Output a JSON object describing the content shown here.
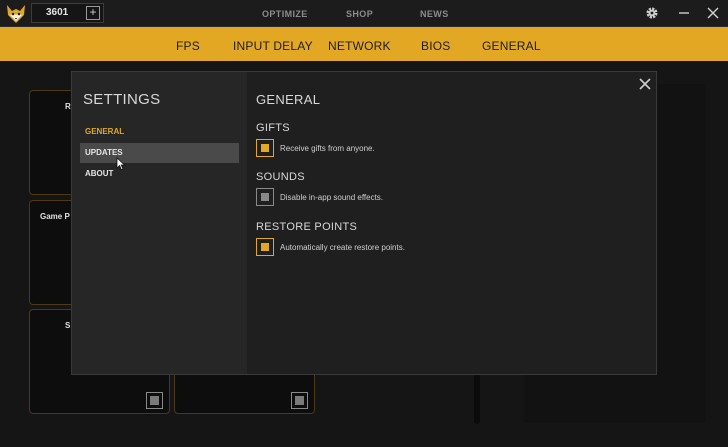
{
  "topbar": {
    "counter_value": "3601",
    "nav": [
      "OPTIMIZE",
      "SHOP",
      "NEWS"
    ]
  },
  "category_nav": [
    "FPS",
    "INPUT DELAY",
    "NETWORK",
    "BIOS",
    "GENERAL"
  ],
  "background_cards": [
    {
      "label": "R"
    },
    {
      "label": "Game P"
    },
    {
      "label": "S"
    }
  ],
  "settings": {
    "title": "SETTINGS",
    "menu": [
      {
        "label": "GENERAL",
        "state": "active"
      },
      {
        "label": "UPDATES",
        "state": "hover"
      },
      {
        "label": "ABOUT",
        "state": "normal"
      }
    ],
    "content_title": "GENERAL",
    "sections": [
      {
        "title": "GIFTS",
        "option": "Receive gifts from anyone.",
        "checked": true
      },
      {
        "title": "SOUNDS",
        "option": "Disable in-app sound effects.",
        "checked": false
      },
      {
        "title": "RESTORE POINTS",
        "option": "Automatically create restore points.",
        "checked": true
      }
    ]
  },
  "colors": {
    "accent": "#e2a824",
    "background": "#161616",
    "modal": "#1f1f1f",
    "sidebar": "#262626"
  },
  "icons": [
    "fox-logo-icon",
    "plus-icon",
    "gear-icon",
    "minimize-icon",
    "close-icon",
    "cursor-icon"
  ]
}
